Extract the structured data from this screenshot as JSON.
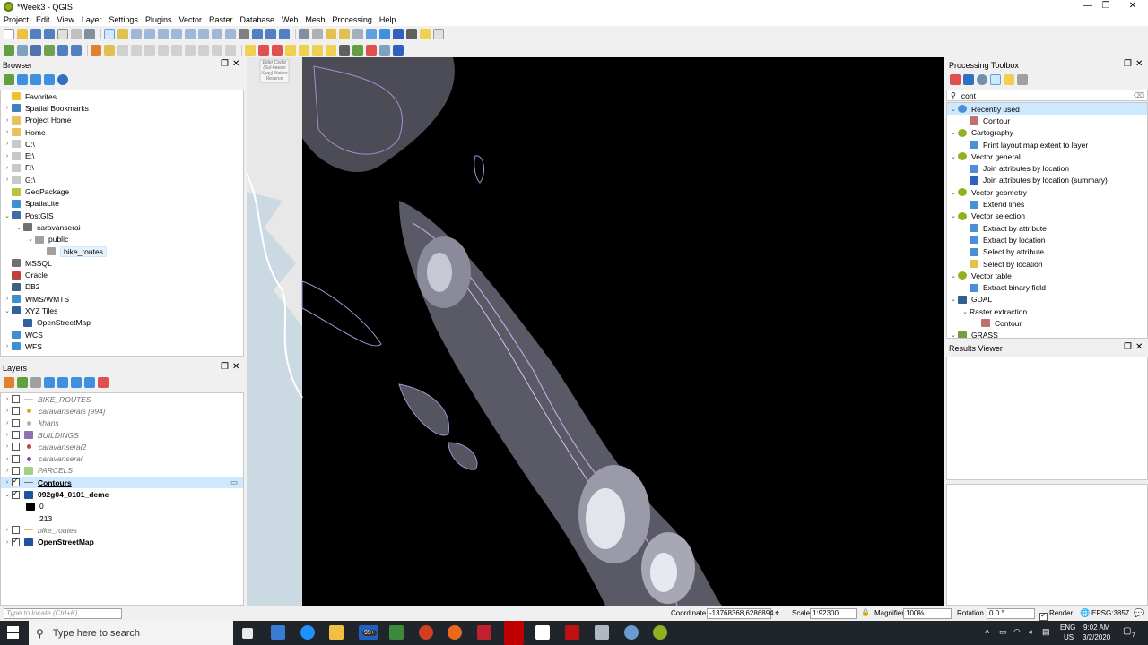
{
  "window": {
    "title": "*Week3 - QGIS",
    "minimize": "—",
    "restore": "❐",
    "close": "✕"
  },
  "menu": [
    "Project",
    "Edit",
    "View",
    "Layer",
    "Settings",
    "Plugins",
    "Vector",
    "Raster",
    "Database",
    "Web",
    "Mesh",
    "Processing",
    "Help"
  ],
  "browser": {
    "title": "Browser",
    "items": [
      {
        "label": "Favorites",
        "icon": "star-icon",
        "indent": 0,
        "arrow": ""
      },
      {
        "label": "Spatial Bookmarks",
        "icon": "bookmark-icon",
        "indent": 0,
        "arrow": "›"
      },
      {
        "label": "Project Home",
        "icon": "folder-icon",
        "indent": 0,
        "arrow": "›"
      },
      {
        "label": "Home",
        "icon": "folder-icon",
        "indent": 0,
        "arrow": "›"
      },
      {
        "label": "C:\\",
        "icon": "drive-icon",
        "indent": 0,
        "arrow": "›"
      },
      {
        "label": "E:\\",
        "icon": "drive-icon",
        "indent": 0,
        "arrow": "›"
      },
      {
        "label": "F:\\",
        "icon": "drive-icon",
        "indent": 0,
        "arrow": "›"
      },
      {
        "label": "G:\\",
        "icon": "drive-icon",
        "indent": 0,
        "arrow": "›"
      },
      {
        "label": "GeoPackage",
        "icon": "geopackage-icon",
        "indent": 0,
        "arrow": ""
      },
      {
        "label": "SpatiaLite",
        "icon": "spatialite-icon",
        "indent": 0,
        "arrow": ""
      },
      {
        "label": "PostGIS",
        "icon": "postgis-icon",
        "indent": 0,
        "arrow": "⌄"
      },
      {
        "label": "caravanserai",
        "icon": "connection-icon",
        "indent": 1,
        "arrow": "⌄"
      },
      {
        "label": "public",
        "icon": "schema-icon",
        "indent": 2,
        "arrow": "⌄"
      },
      {
        "label": "bike_routes",
        "icon": "line-layer-icon",
        "indent": 3,
        "arrow": "",
        "selected": true
      },
      {
        "label": "MSSQL",
        "icon": "mssql-icon",
        "indent": 0,
        "arrow": ""
      },
      {
        "label": "Oracle",
        "icon": "oracle-icon",
        "indent": 0,
        "arrow": ""
      },
      {
        "label": "DB2",
        "icon": "db2-icon",
        "indent": 0,
        "arrow": ""
      },
      {
        "label": "WMS/WMTS",
        "icon": "globe-icon",
        "indent": 0,
        "arrow": "›"
      },
      {
        "label": "XYZ Tiles",
        "icon": "grid-icon",
        "indent": 0,
        "arrow": "⌄"
      },
      {
        "label": "OpenStreetMap",
        "icon": "grid-icon",
        "indent": 1,
        "arrow": ""
      },
      {
        "label": "WCS",
        "icon": "globe-icon",
        "indent": 0,
        "arrow": ""
      },
      {
        "label": "WFS",
        "icon": "globe-icon",
        "indent": 0,
        "arrow": "›"
      }
    ]
  },
  "layers": {
    "title": "Layers",
    "items": [
      {
        "label": "BIKE_ROUTES",
        "checked": false,
        "style": "italic-grey",
        "icon": "line-layer-icon",
        "sym": "#c8c8c8"
      },
      {
        "label": "caravanserais [994]",
        "checked": false,
        "style": "italic-grey",
        "icon": "point-layer-icon",
        "sym": "#e0a030"
      },
      {
        "label": "khans",
        "checked": false,
        "style": "italic-grey",
        "icon": "point-layer-icon",
        "sym": "#b0b0b0"
      },
      {
        "label": "BUILDINGS",
        "checked": false,
        "style": "italic-grey",
        "icon": "polygon-layer-icon",
        "sym": "#9070b0"
      },
      {
        "label": "caravanserai2",
        "checked": false,
        "style": "italic-grey",
        "icon": "point-layer-icon",
        "sym": "#c04040"
      },
      {
        "label": "caravanserai",
        "checked": false,
        "style": "italic-grey",
        "icon": "point-layer-icon",
        "sym": "#8050a0"
      },
      {
        "label": "PARCELS",
        "checked": false,
        "style": "italic-grey",
        "icon": "polygon-layer-icon",
        "sym": "#a0d080"
      },
      {
        "label": "Contours",
        "checked": true,
        "style": "bold-underline",
        "icon": "line-layer-icon",
        "sym": "#707070",
        "selected": true
      },
      {
        "label": "092g04_0101_deme",
        "checked": true,
        "style": "bold",
        "icon": "raster-layer-icon",
        "sym": "#2050a0",
        "group": true
      },
      {
        "label": "0",
        "checked": null,
        "style": "legend",
        "icon": "legend-swatch-icon",
        "sym": "#000000"
      },
      {
        "label": "213",
        "checked": null,
        "style": "legend",
        "icon": "",
        "sym": ""
      },
      {
        "label": "bike_routes",
        "checked": false,
        "style": "italic-grey",
        "icon": "line-layer-icon",
        "sym": "#e0c060"
      },
      {
        "label": "OpenStreetMap",
        "checked": true,
        "style": "bold",
        "icon": "raster-layer-icon",
        "sym": "#2050a0"
      }
    ]
  },
  "toolbox": {
    "title": "Processing Toolbox",
    "search_value": "cont",
    "items": [
      {
        "label": "Recently used",
        "indent": 0,
        "arrow": "⌄",
        "icon": "clock-icon",
        "highlight": true
      },
      {
        "label": "Contour",
        "indent": 1,
        "arrow": "",
        "icon": "gdal-tool-icon"
      },
      {
        "label": "Cartography",
        "indent": 0,
        "arrow": "⌄",
        "icon": "qgis-icon"
      },
      {
        "label": "Print layout map extent to layer",
        "indent": 1,
        "arrow": "",
        "icon": "gear-icon"
      },
      {
        "label": "Vector general",
        "indent": 0,
        "arrow": "⌄",
        "icon": "qgis-icon"
      },
      {
        "label": "Join attributes by location",
        "indent": 1,
        "arrow": "",
        "icon": "gear-icon"
      },
      {
        "label": "Join attributes by location (summary)",
        "indent": 1,
        "arrow": "",
        "icon": "sigma-icon"
      },
      {
        "label": "Vector geometry",
        "indent": 0,
        "arrow": "⌄",
        "icon": "qgis-icon"
      },
      {
        "label": "Extend lines",
        "indent": 1,
        "arrow": "",
        "icon": "gear-icon"
      },
      {
        "label": "Vector selection",
        "indent": 0,
        "arrow": "⌄",
        "icon": "qgis-icon"
      },
      {
        "label": "Extract by attribute",
        "indent": 1,
        "arrow": "",
        "icon": "gear-icon"
      },
      {
        "label": "Extract by location",
        "indent": 1,
        "arrow": "",
        "icon": "gear-icon"
      },
      {
        "label": "Select by attribute",
        "indent": 1,
        "arrow": "",
        "icon": "gear-icon"
      },
      {
        "label": "Select by location",
        "indent": 1,
        "arrow": "",
        "icon": "select-icon"
      },
      {
        "label": "Vector table",
        "indent": 0,
        "arrow": "⌄",
        "icon": "qgis-icon"
      },
      {
        "label": "Extract binary field",
        "indent": 1,
        "arrow": "",
        "icon": "gear-icon"
      },
      {
        "label": "GDAL",
        "indent": 0,
        "arrow": "⌄",
        "icon": "gdal-icon"
      },
      {
        "label": "Raster extraction",
        "indent": 1,
        "arrow": "⌄",
        "icon": ""
      },
      {
        "label": "Contour",
        "indent": 2,
        "arrow": "",
        "icon": "gdal-tool-icon"
      },
      {
        "label": "GRASS",
        "indent": 0,
        "arrow": "⌄",
        "icon": "grass-icon"
      }
    ]
  },
  "results_viewer": {
    "title": "Results Viewer"
  },
  "map": {
    "label_text": "Elder Cedar (Sul-hween Xpay) Nature Reserve"
  },
  "statusbar": {
    "locate_placeholder": "Type to locate (Ctrl+K)",
    "coordinate_label": "Coordinate",
    "coordinate_value": "-13768368,6286894",
    "scale_label": "Scale",
    "scale_value": "1:92300",
    "magnifier_label": "Magnifier",
    "magnifier_value": "100%",
    "rotation_label": "Rotation",
    "rotation_value": "0.0 °",
    "render_label": "Render",
    "crs_label": "EPSG:3857"
  },
  "taskbar": {
    "search_placeholder": "Type here to search",
    "lang": "ENG",
    "region": "US",
    "time": "9:02 AM",
    "date": "3/2/2020",
    "notif_count": "7",
    "badge_count": "99+"
  },
  "colors": {
    "accent": "#cde8ff",
    "map_bg": "#000000",
    "contour": "#9a86c8",
    "taskbar": "#20252b"
  }
}
